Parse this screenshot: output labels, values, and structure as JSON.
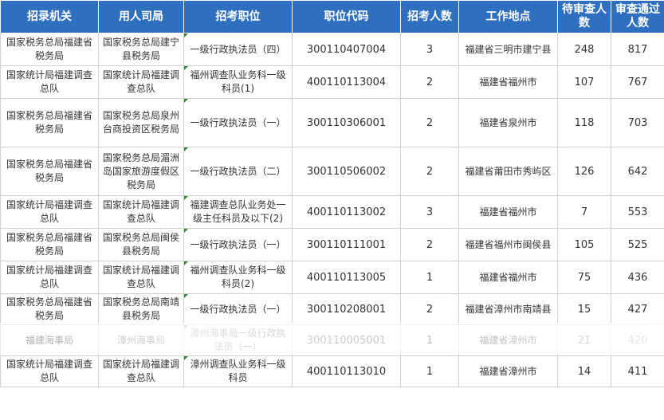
{
  "headers": [
    "招录机关",
    "用人司局",
    "招考职位",
    "职位代码",
    "招考人数",
    "工作地点",
    "待审查人数",
    "审查通过人数"
  ],
  "rows": [
    [
      "国家税务总局福建省税务局",
      "国家税务总局建宁县税务局",
      "一级行政执法员（四）",
      "300110407004",
      "3",
      "福建省三明市建宁县",
      "248",
      "817"
    ],
    [
      "国家统计局福建调查总队",
      "国家统计局福建调查总队",
      "福州调查队业务科一级科员(1)",
      "400110113004",
      "2",
      "福建省福州市",
      "107",
      "767"
    ],
    [
      "国家税务总局福建省税务局",
      "国家税务总局泉州台商投资区税务局",
      "一级行政执法员（一）",
      "300110306001",
      "2",
      "福建省泉州市",
      "118",
      "703"
    ],
    [
      "国家税务总局福建省税务局",
      "国家税务总局湄洲岛国家旅游度假区税务局",
      "一级行政执法员（二）",
      "300110506002",
      "2",
      "福建省莆田市秀屿区",
      "126",
      "642"
    ],
    [
      "国家统计局福建调查总队",
      "国家统计局福建调查总队",
      "福建调查总队业务处一级主任科员及以下(2)",
      "400110113002",
      "3",
      "福建省福州市",
      "7",
      "553"
    ],
    [
      "国家税务总局福建省税务局",
      "国家税务总局闽侯县税务局",
      "一级行政执法员（一）",
      "300110111001",
      "2",
      "福建省福州市闽侯县",
      "105",
      "525"
    ],
    [
      "国家统计局福建调查总队",
      "国家统计局福建调查总队",
      "福州调查队业务科一级科员(2)",
      "400110113005",
      "1",
      "福建省福州市",
      "75",
      "436"
    ],
    [
      "国家税务总局福建省税务局",
      "国家税务总局南靖县税务局",
      "一级行政执法员（一）",
      "300110208001",
      "2",
      "福建省漳州市南靖县",
      "15",
      "427"
    ],
    [
      "福建海事局",
      "漳州海事局",
      "漳州海事局一级行政执法员（一）",
      "300110005001",
      "1",
      "福建省漳州市",
      "21",
      "420"
    ],
    [
      "国家统计局福建调查总队",
      "国家统计局福建调查总队",
      "漳州调查队业务科一级科员",
      "400110113010",
      "1",
      "福建省漳州市",
      "14",
      "411"
    ]
  ]
}
